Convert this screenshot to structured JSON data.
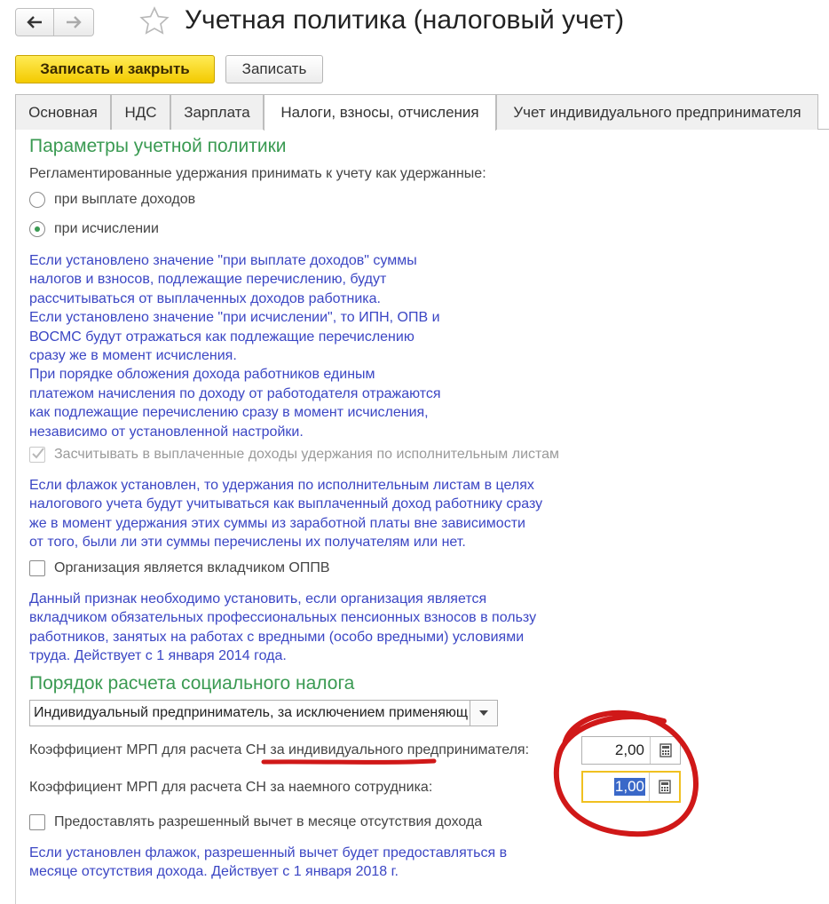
{
  "window": {
    "title": "Учетная политика (налоговый учет)"
  },
  "toolbar": {
    "save_close_label": "Записать и закрыть",
    "save_label": "Записать"
  },
  "tabs": [
    {
      "label": "Основная",
      "active": false
    },
    {
      "label": "НДС",
      "active": false
    },
    {
      "label": "Зарплата",
      "active": false
    },
    {
      "label": "Налоги, взносы, отчисления",
      "active": true
    },
    {
      "label": "Учет индивидуального предпринимателя",
      "active": false
    }
  ],
  "params": {
    "title": "Параметры учетной политики",
    "retention_label": "Регламентированные удержания принимать к учету как удержанные:",
    "radio_payment": "при выплате доходов",
    "radio_calculation": "при исчислении",
    "selected_option": "при исчислении",
    "help1": [
      "Если установлено значение \"при выплате доходов\" суммы",
      "налогов и взносов, подлежащие перечислению, будут",
      "рассчитываться от выплаченных доходов работника.",
      "Если установлено значение \"при исчислении\", то ИПН, ОПВ и",
      "ВОСМС будут отражаться как подлежащие перечислению",
      "сразу же в момент исчисления.",
      "При порядке обложения дохода работников единым",
      "платежом начисления по доходу от работодателя отражаются",
      "как подлежащие перечислению сразу в момент исчисления,",
      "независимо от установленной настройки."
    ],
    "checkbox_writs": "Засчитывать в выплаченные доходы удержания по исполнительным листам",
    "checkbox_writs_checked": true,
    "help2": [
      "Если флажок установлен, то удержания по исполнительным листам в целях",
      "налогового учета будут учитываться как выплаченный доход работнику сразу",
      "же в момент удержания этих суммы из заработной платы вне зависимости",
      "от того, были ли эти суммы перечислены их получателям или нет."
    ],
    "checkbox_oppv": "Организация является вкладчиком ОППВ",
    "checkbox_oppv_checked": false,
    "help3": [
      "Данный признак необходимо установить, если организация является",
      "вкладчиком обязательных профессиональных пенсионных взносов в пользу",
      "работников, занятых на работах с вредными (особо вредными) условиями",
      "труда. Действует с 1 января 2014 года."
    ]
  },
  "social_tax": {
    "title": "Порядок расчета социального налога",
    "select_value": "Индивидуальный предприниматель, за исключением применяющих специальные налоговые режимы",
    "coef_ip_label": "Коэффициент МРП для расчета СН за индивидуального предпринимателя:",
    "coef_ip_value": "2,00",
    "coef_employee_label": "Коэффициент МРП для расчета СН за наемного сотрудника:",
    "coef_employee_value": "1,00",
    "checkbox_deduction": "Предоставлять разрешенный вычет в месяце отсутствия дохода",
    "checkbox_deduction_checked": false,
    "help4": [
      "Если установлен флажок, разрешенный вычет будет предоставляться в",
      "месяце отсутствия дохода. Действует с 1 января 2018 г."
    ]
  },
  "icons": {
    "back": "arrow-left-icon",
    "forward": "arrow-right-icon",
    "favorite": "star-icon",
    "dropdown": "triangle-down-icon",
    "calculator": "calculator-icon"
  },
  "colors": {
    "section_title": "#3a9a52",
    "help_text": "#3b46c4",
    "primary_button": "#f3ca00",
    "annotation": "#d01818"
  }
}
